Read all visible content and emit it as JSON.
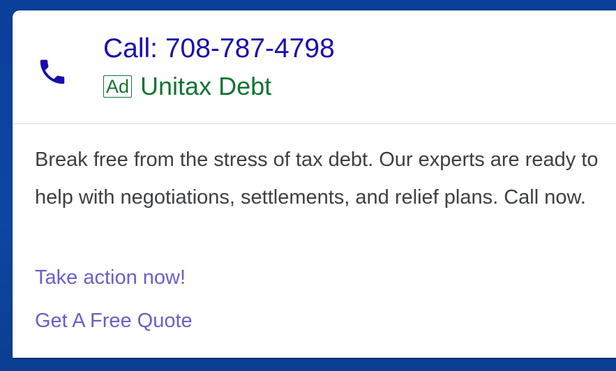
{
  "ad": {
    "call_text": "Call: 708-787-4798",
    "badge": "Ad",
    "advertiser": "Unitax Debt",
    "description": "Break free from the stress of tax debt. Our experts are ready to help with negotiations, settlements, and relief plans. Call now.",
    "sitelinks": [
      "Take action now!",
      "Get A Free Quote"
    ],
    "icon": "phone-icon"
  },
  "colors": {
    "background": "#0d47a1",
    "call_link": "#1a0dab",
    "ad_green": "#137333",
    "sitelink": "#6a5fc8",
    "phone_icon": "#1a0dab"
  }
}
